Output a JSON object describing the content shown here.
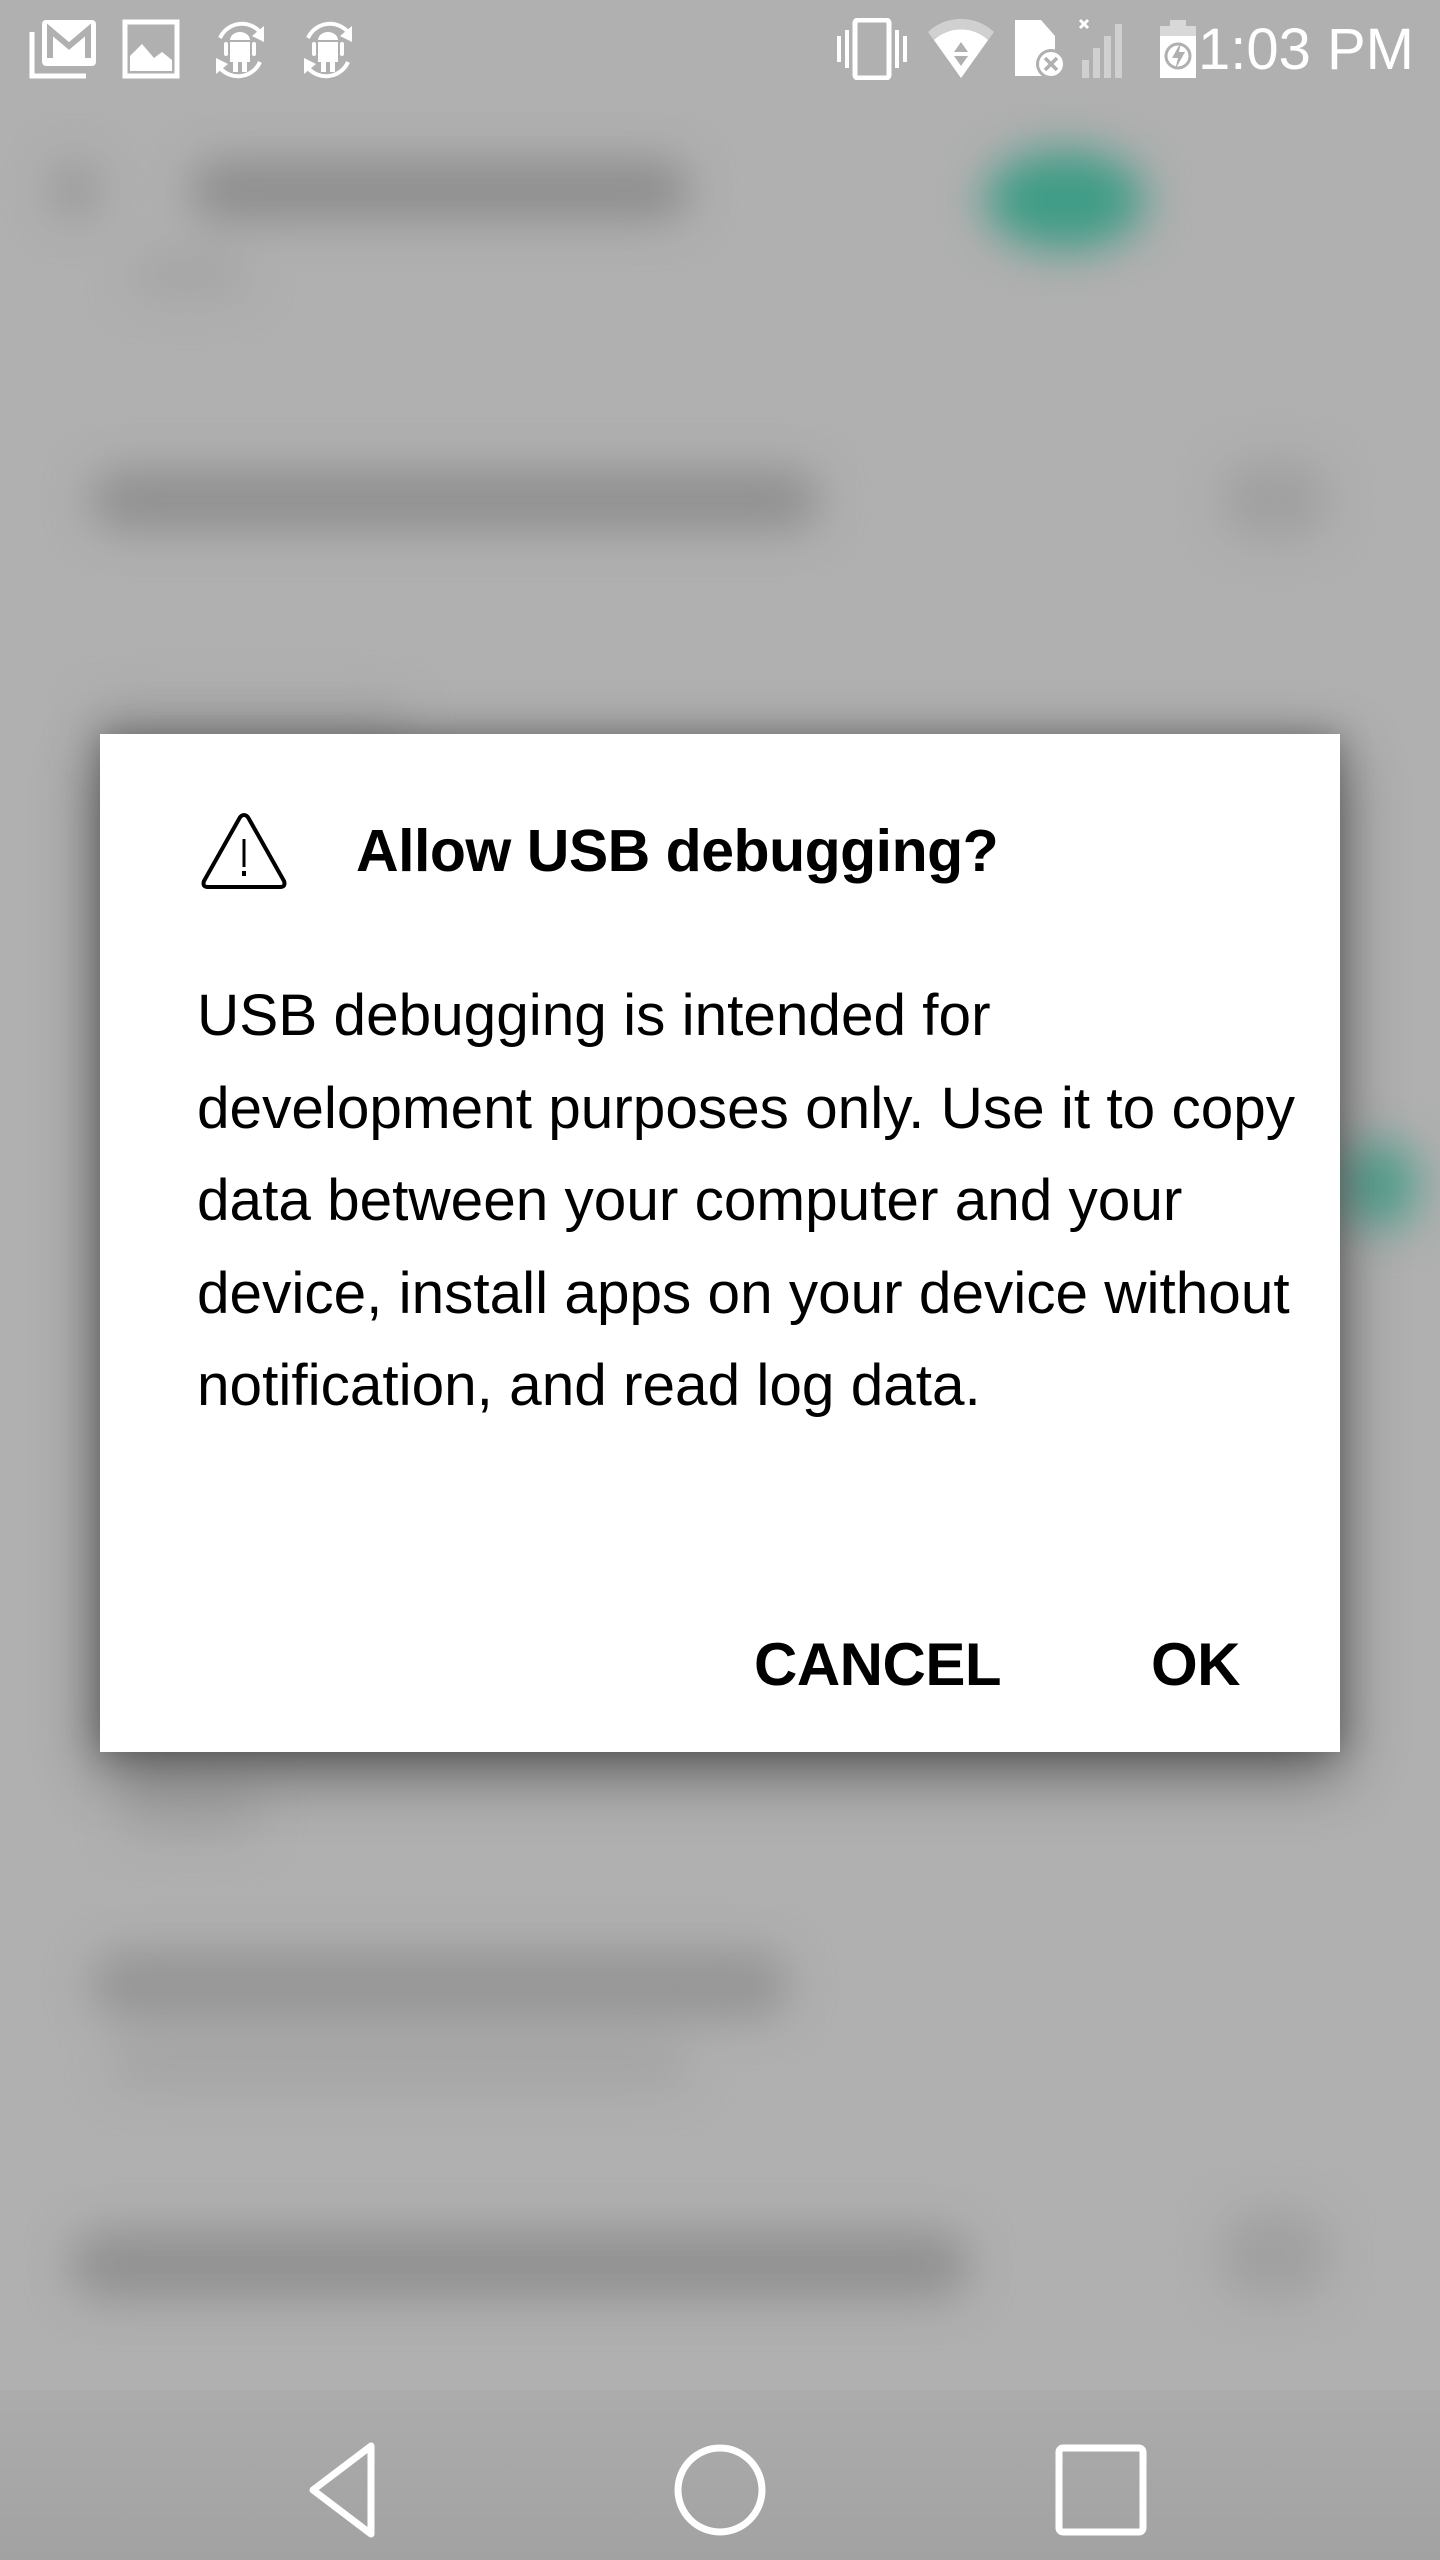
{
  "status_bar": {
    "time": "1:03 PM",
    "notification_icons": [
      "gmail-icon",
      "gallery-icon",
      "android-sync-icon",
      "android-sync-icon"
    ],
    "system_icons": [
      "vibrate-icon",
      "wifi-icon",
      "no-sim-icon",
      "signal-off-icon",
      "battery-charging-icon"
    ]
  },
  "dialog": {
    "icon": "warning-icon",
    "title": "Allow USB debugging?",
    "body": "USB debugging is intended for development purposes only. Use it to copy data between your computer and your device, install apps on your device without notification, and read log data.",
    "buttons": {
      "cancel": "CANCEL",
      "ok": "OK"
    }
  },
  "nav_bar": {
    "buttons": [
      "back-icon",
      "home-icon",
      "recents-icon"
    ]
  },
  "colors": {
    "background_scrim": "#b0b0b0",
    "accent_teal": "#3f9c86",
    "dialog_bg": "#ffffff",
    "text": "#000000"
  }
}
